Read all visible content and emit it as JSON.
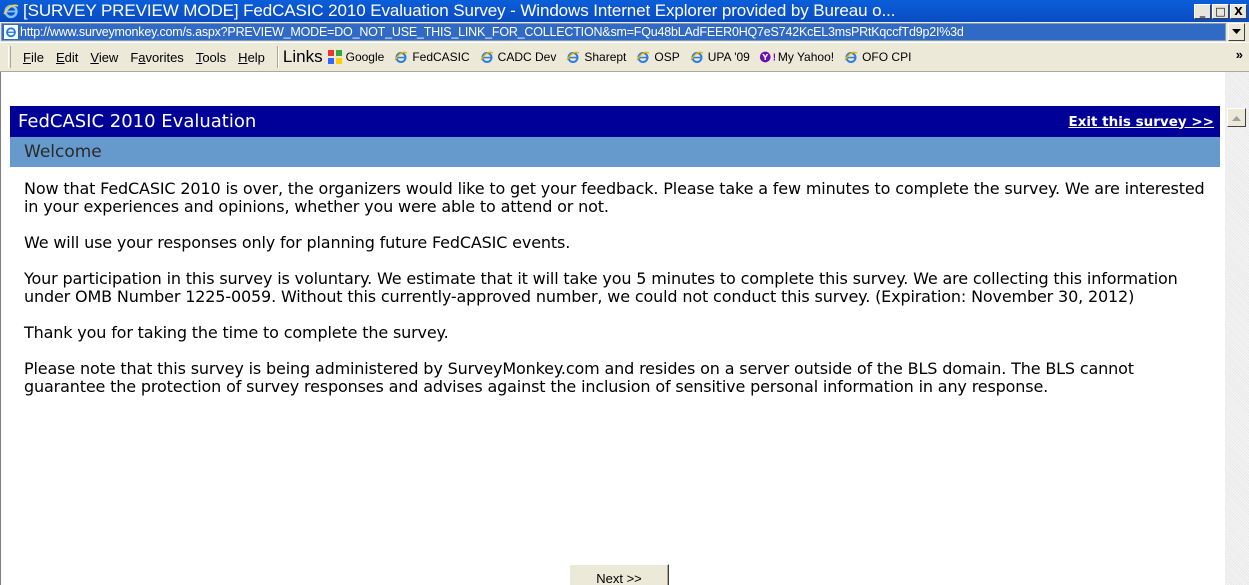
{
  "window": {
    "title": "[SURVEY PREVIEW MODE] FedCASIC 2010 Evaluation Survey - Windows Internet Explorer provided by Bureau o...",
    "buttons": {
      "minimize": "_",
      "restore": "□",
      "close": "X"
    }
  },
  "address": {
    "url": "http://www.surveymonkey.com/s.aspx?PREVIEW_MODE=DO_NOT_USE_THIS_LINK_FOR_COLLECTION&sm=FQu48bLAdFEER0HQ7eS742KcEL3msPRtKqccfTd9p2I%3d"
  },
  "menu": {
    "items": [
      {
        "label": "File",
        "key": "F",
        "rest": "ile"
      },
      {
        "label": "Edit",
        "key": "E",
        "rest": "dit"
      },
      {
        "label": "View",
        "key": "V",
        "rest": "iew"
      },
      {
        "label": "Favorites",
        "pre": "F",
        "key": "a",
        "rest": "vorites"
      },
      {
        "label": "Tools",
        "key": "T",
        "rest": "ools"
      },
      {
        "label": "Help",
        "key": "H",
        "rest": "elp"
      }
    ]
  },
  "links": {
    "label": "Links",
    "items": [
      {
        "label": "Google",
        "icon": "google-icon"
      },
      {
        "label": "FedCASIC",
        "icon": "ie-icon"
      },
      {
        "label": "CADC Dev",
        "icon": "ie-icon"
      },
      {
        "label": "Sharept",
        "icon": "ie-icon"
      },
      {
        "label": "OSP",
        "icon": "ie-icon"
      },
      {
        "label": "UPA '09",
        "icon": "ie-icon"
      },
      {
        "label": "My Yahoo!",
        "icon": "yahoo-icon"
      },
      {
        "label": "OFO CPI",
        "icon": "ie-icon"
      }
    ],
    "more": "»"
  },
  "survey": {
    "title": "FedCASIC 2010 Evaluation",
    "exit_link": "Exit this survey >>",
    "section": "Welcome",
    "paragraphs": [
      "Now that FedCASIC 2010 is over, the organizers would like to get your feedback. Please take a few minutes to complete the survey. We are interested in your experiences and opinions, whether you were able to attend or not.",
      "We will use your responses only for planning future FedCASIC events.",
      "Your participation in this survey is voluntary. We estimate that it will take you 5 minutes to complete this survey. We are collecting this information under OMB Number 1225-0059. Without this currently-approved number, we could not conduct this survey. (Expiration: November 30, 2012)",
      "Thank you for taking the time to complete the survey.",
      "Please note that this survey is being administered by SurveyMonkey.com and resides on a server outside of the BLS domain. The BLS cannot guarantee the protection of survey responses and advises against the inclusion of sensitive personal information in any response."
    ],
    "next_button": "Next >>"
  },
  "colors": {
    "header_bg": "#000099",
    "section_bg": "#6699cc",
    "titlebar_bg": "#0b56d1"
  }
}
